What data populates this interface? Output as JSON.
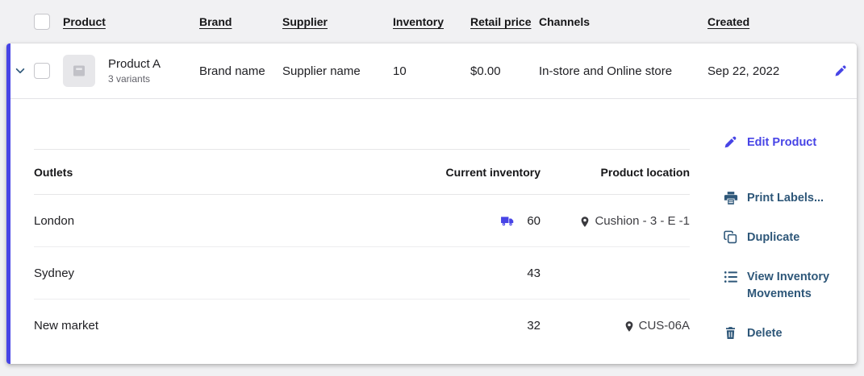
{
  "colors": {
    "accent_indigo": "#4744e6",
    "action_blue": "#2e5779",
    "card_background": "#ffffff",
    "page_background": "#f1f1f3"
  },
  "table": {
    "columns": [
      {
        "label": "Product",
        "sortable": true
      },
      {
        "label": "Brand",
        "sortable": true
      },
      {
        "label": "Supplier",
        "sortable": true
      },
      {
        "label": "Inventory",
        "sortable": true
      },
      {
        "label": "Retail price",
        "sortable": true
      },
      {
        "label": "Channels",
        "sortable": false
      },
      {
        "label": "Created",
        "sortable": true
      }
    ],
    "row": {
      "product_name": "Product A",
      "variants": "3 variants",
      "brand": "Brand name",
      "supplier": "Supplier name",
      "inventory": "10",
      "retail_price": "$0.00",
      "channels": "In-store and Online store",
      "created": "Sep 22, 2022",
      "expanded": true
    }
  },
  "expanded": {
    "outlets_table": {
      "headers": {
        "outlets": "Outlets",
        "current_inventory": "Current inventory",
        "product_location": "Product location"
      },
      "rows": [
        {
          "outlet": "London",
          "inventory": "60",
          "has_shipment_icon": true,
          "location": "Cushion - 3 - E -1"
        },
        {
          "outlet": "Sydney",
          "inventory": "43",
          "has_shipment_icon": false,
          "location": ""
        },
        {
          "outlet": "New market",
          "inventory": "32",
          "has_shipment_icon": false,
          "location": "CUS-06A"
        }
      ]
    },
    "actions": [
      {
        "label": "Edit Product",
        "icon": "pencil-icon"
      },
      {
        "label": "Print Labels...",
        "icon": "printer-icon"
      },
      {
        "label": "Duplicate",
        "icon": "duplicate-icon"
      },
      {
        "label": "View Inventory Movements",
        "icon": "list-icon"
      },
      {
        "label": "Delete",
        "icon": "trash-icon"
      }
    ]
  }
}
